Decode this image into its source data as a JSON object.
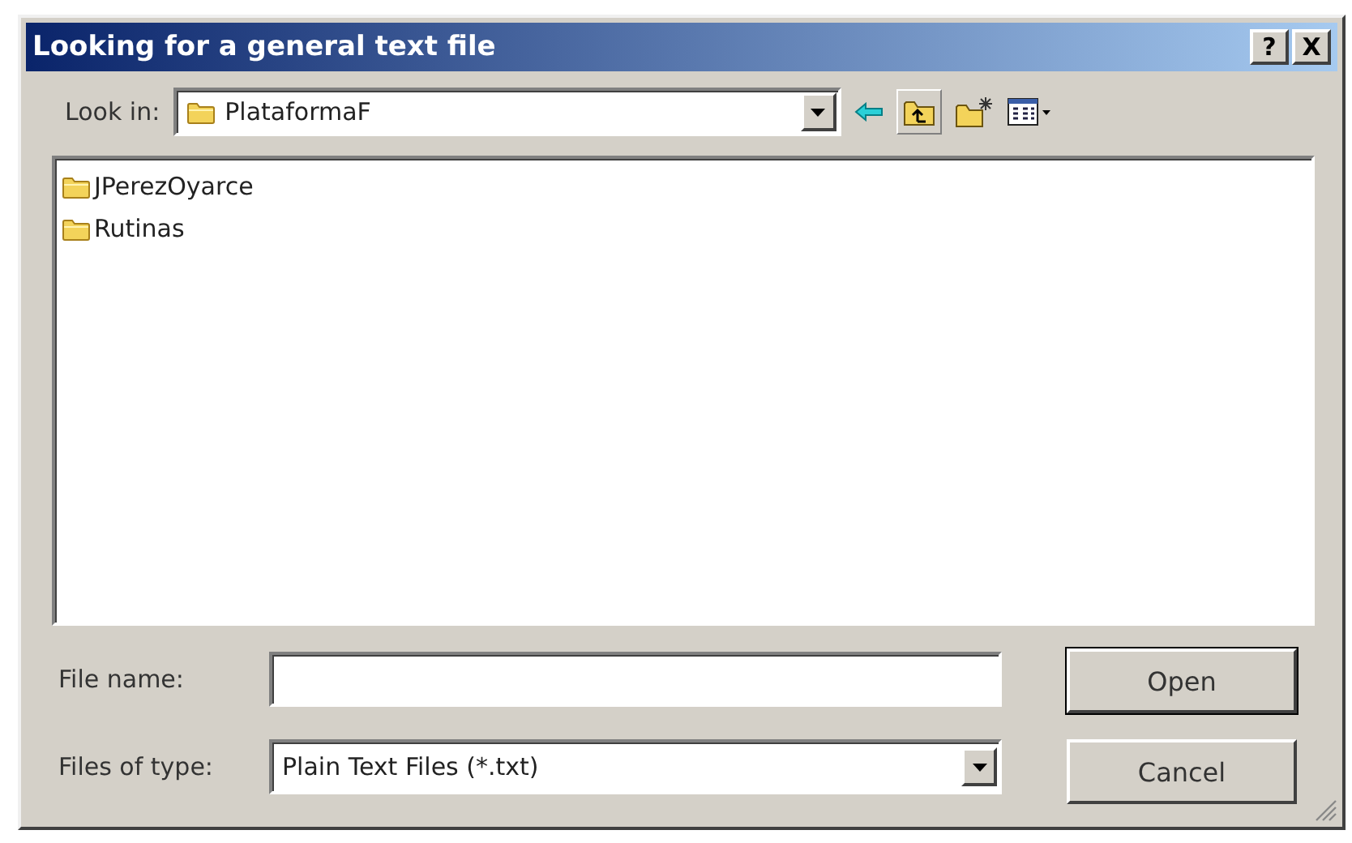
{
  "window": {
    "title": "Looking for a general text file",
    "help_button": "?",
    "close_button": "X"
  },
  "look_in": {
    "label": "Look in:",
    "value": "PlataformaF"
  },
  "files": [
    {
      "name": "JPerezOyarce"
    },
    {
      "name": "Rutinas"
    }
  ],
  "file_name": {
    "label": "File name:"
  },
  "file_type": {
    "label": "Files of type:",
    "value": "Plain Text Files (*.txt)"
  },
  "buttons": [
    {
      "label": "Open",
      "default": true
    },
    {
      "label": "Cancel",
      "default": false
    }
  ]
}
